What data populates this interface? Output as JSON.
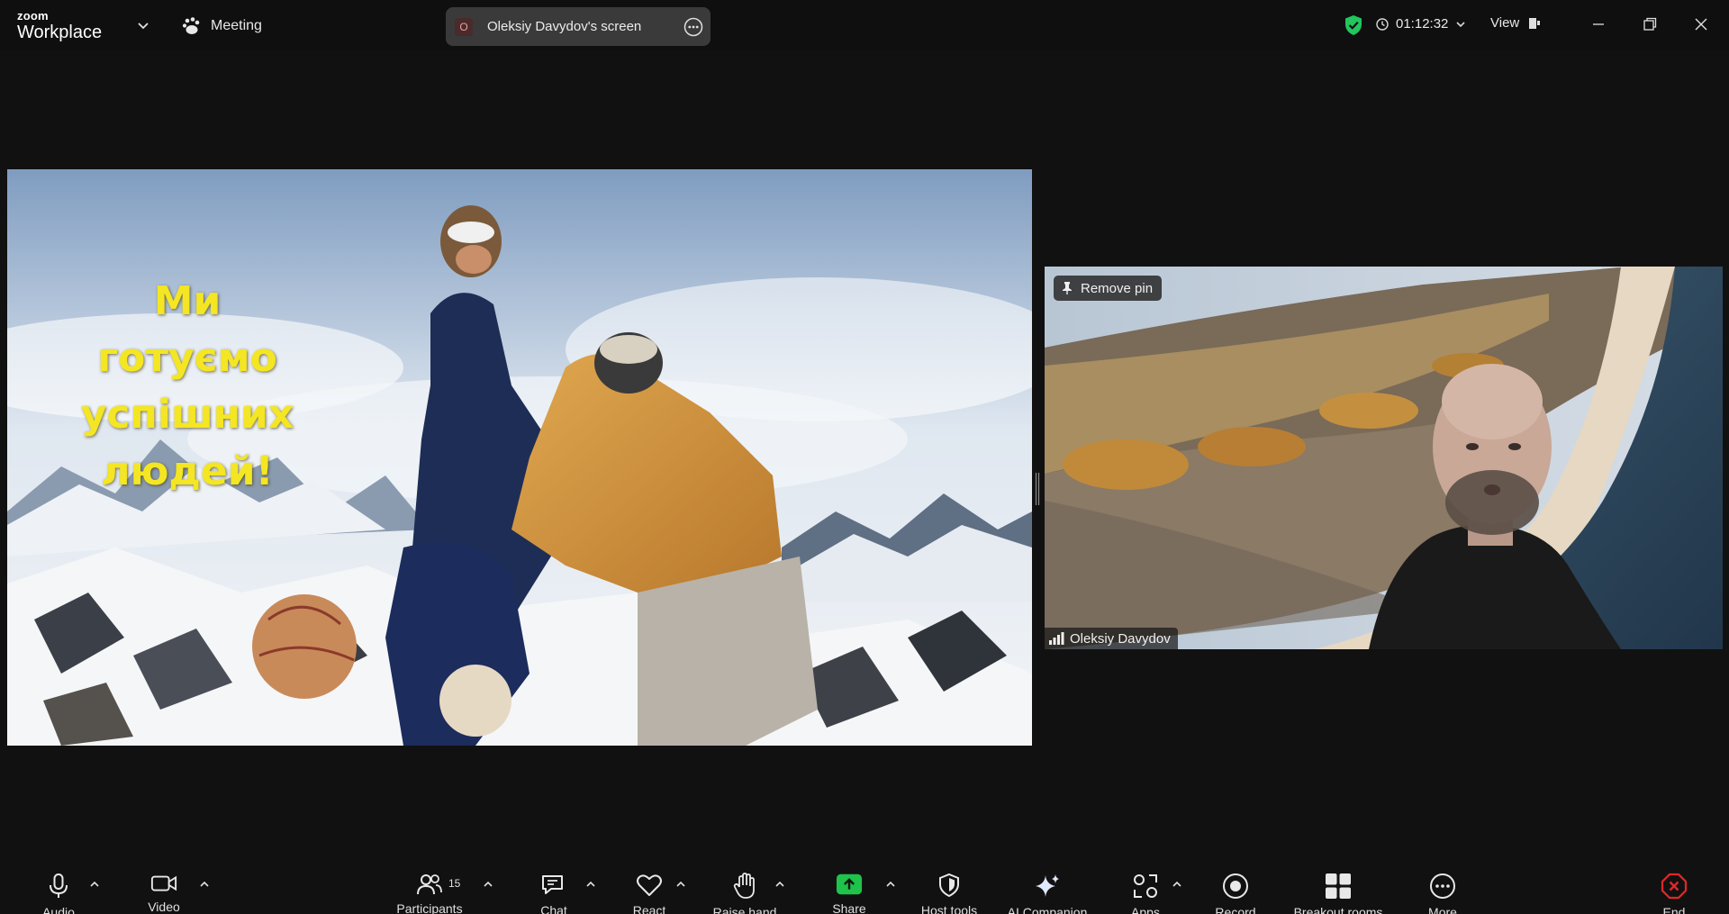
{
  "app": {
    "brand_small": "zoom",
    "brand_large": "Workplace"
  },
  "header": {
    "meeting_label": "Meeting",
    "share_indicator": {
      "avatar_letter": "O",
      "label": "Oleksiy Davydov's screen"
    },
    "timer": "01:12:32",
    "view_label": "View"
  },
  "shared_screen": {
    "slide_lines": [
      "Ми",
      "готуємо",
      "успішних",
      "людей!"
    ]
  },
  "participant_video": {
    "remove_pin_label": "Remove pin",
    "name": "Oleksiy Davydov"
  },
  "toolbar": {
    "audio": "Audio",
    "video": "Video",
    "participants": "Participants",
    "participants_count": "15",
    "chat": "Chat",
    "react": "React",
    "raise_hand": "Raise hand",
    "share": "Share",
    "host_tools": "Host tools",
    "ai_companion": "AI Companion",
    "apps": "Apps",
    "record": "Record",
    "breakout_rooms": "Breakout rooms",
    "more": "More",
    "end": "End"
  },
  "colors": {
    "share_green": "#1fc24a",
    "end_red": "#e02828",
    "shield_green": "#22c55e",
    "slide_text_yellow": "#f4e622"
  }
}
